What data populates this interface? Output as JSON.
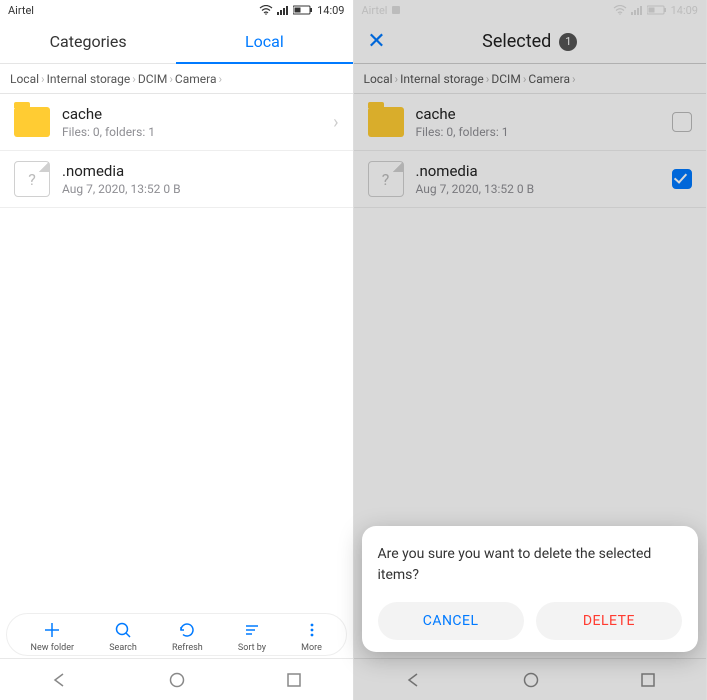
{
  "status": {
    "carrier": "Airtel",
    "time": "14:09"
  },
  "left": {
    "tabs": {
      "categories": "Categories",
      "local": "Local"
    },
    "breadcrumb": [
      "Local",
      "Internal storage",
      "DCIM",
      "Camera"
    ],
    "items": [
      {
        "name": "cache",
        "meta": "Files: 0, folders: 1",
        "kind": "folder"
      },
      {
        "name": ".nomedia",
        "meta": "Aug 7, 2020, 13:52 0 B",
        "kind": "file"
      }
    ],
    "toolbar": {
      "new_folder": "New folder",
      "search": "Search",
      "refresh": "Refresh",
      "sort_by": "Sort by",
      "more": "More"
    }
  },
  "right": {
    "header": {
      "title": "Selected",
      "count": "1"
    },
    "breadcrumb": [
      "Local",
      "Internal storage",
      "DCIM",
      "Camera"
    ],
    "items": [
      {
        "name": "cache",
        "meta": "Files: 0, folders: 1",
        "kind": "folder",
        "checked": false
      },
      {
        "name": ".nomedia",
        "meta": "Aug 7, 2020, 13:52 0 B",
        "kind": "file",
        "checked": true
      }
    ],
    "dialog": {
      "message": "Are you sure you want to delete the selected items?",
      "cancel": "CANCEL",
      "delete": "DELETE"
    }
  }
}
